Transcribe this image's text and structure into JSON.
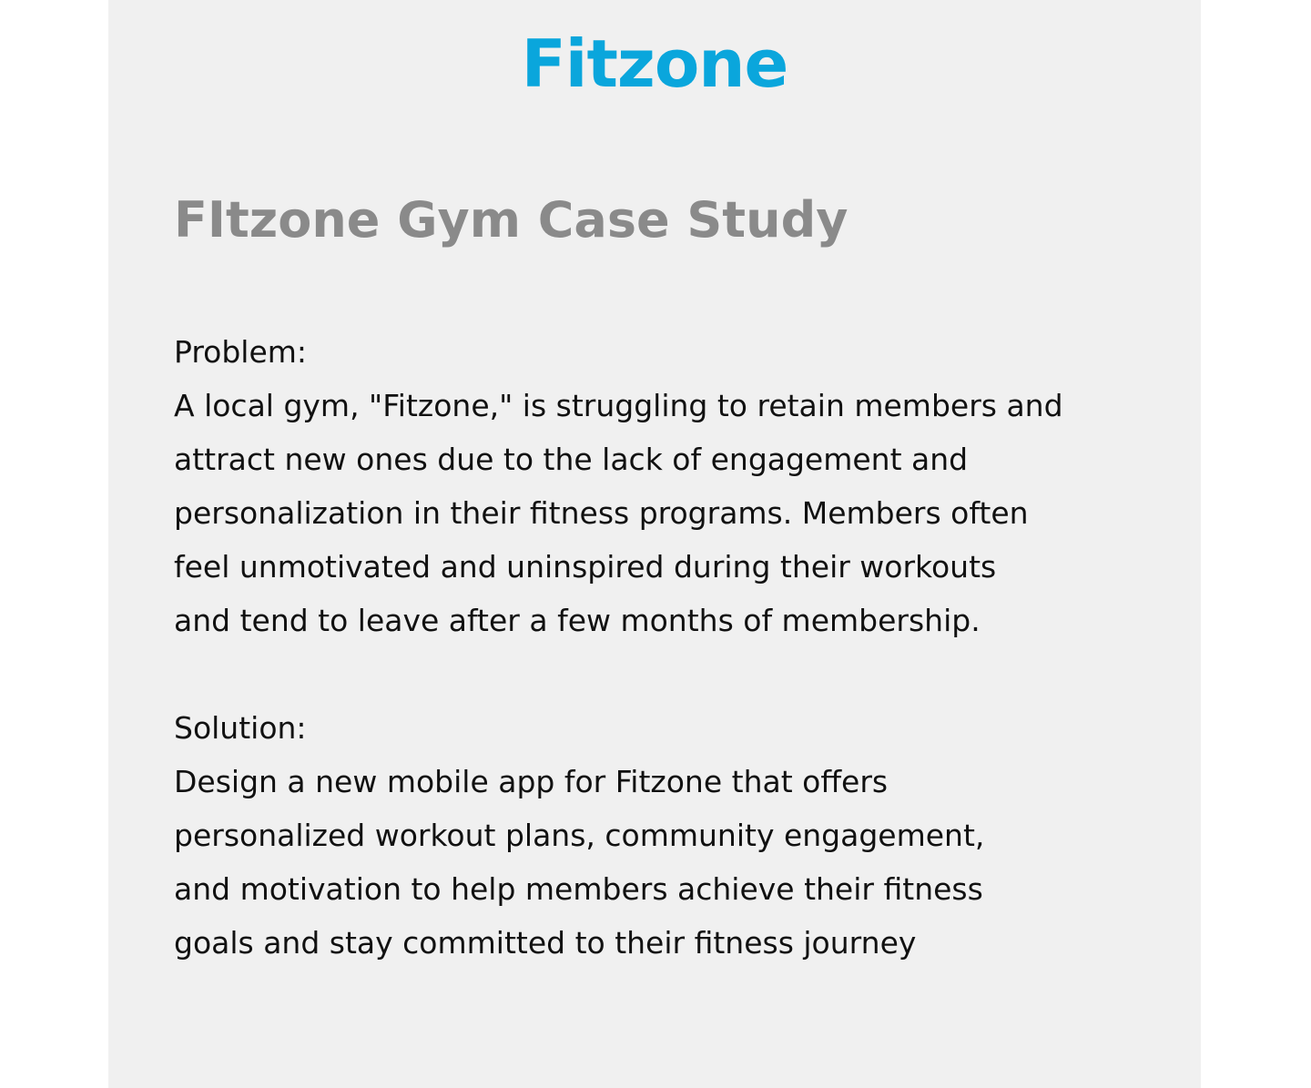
{
  "logo": "Fitzone",
  "title": "FItzone Gym Case Study",
  "problem": {
    "heading": "Problem:",
    "lines": [
      "A local gym, \"Fitzone,\" is struggling to retain members and",
      "attract new ones due to the lack of engagement and",
      "personalization in their fitness programs. Members often",
      "feel unmotivated and uninspired during their workouts",
      "and tend to leave after a few months of membership."
    ]
  },
  "solution": {
    "heading": "Solution:",
    "lines": [
      "Design a new mobile app for Fitzone that offers",
      "personalized workout plans, community engagement,",
      "and motivation to help members achieve their fitness",
      "goals and stay committed to their fitness journey"
    ]
  },
  "colors": {
    "logo": "#0aa6dc",
    "title": "#8a8a8a",
    "panel_background": "#f0f0f0",
    "body_text": "#111111"
  }
}
